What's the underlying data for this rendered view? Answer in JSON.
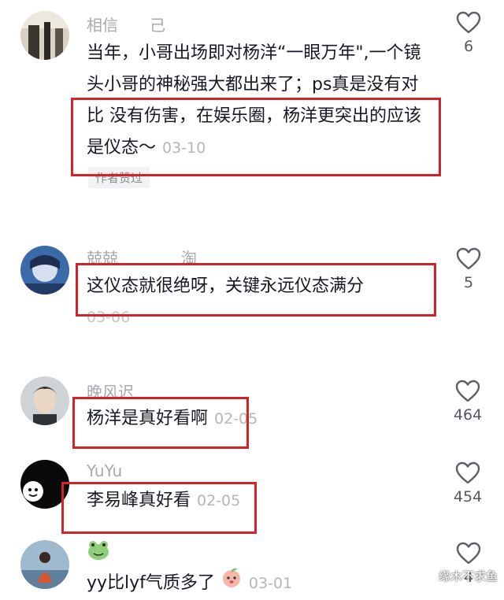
{
  "comments": [
    {
      "username": "相信　　己",
      "text": "当年，小哥出场即对杨洋“一眼万年\",一个镜头小哥的神秘强大都出来了；ps真是没有对比 没有伤害，在娱乐圈，杨洋更突出的应该是仪态～",
      "time": "03-10",
      "badge": "作者赞过",
      "likes": "6"
    },
    {
      "username": "兢兢　　　　淘",
      "text": "这仪态就很绝呀，关键永远仪态满分",
      "time": "03-06",
      "likes": "5"
    },
    {
      "username": "晚风迟",
      "text": "杨洋是真好看啊",
      "time": "02-05",
      "likes": "464"
    },
    {
      "username": "YuYu",
      "text": "李易峰真好看",
      "time": "02-05",
      "likes": "454"
    },
    {
      "username": "",
      "text": "yy比lyf气质多了",
      "time": "03-01",
      "likes": "4"
    }
  ],
  "watermark": "缘木不求鱼",
  "colors": {
    "highlight": "#d2222a",
    "meta": "#b5b6ba"
  },
  "icons": {
    "like": "heart-outline-icon",
    "emoji": "peach-face-icon"
  }
}
